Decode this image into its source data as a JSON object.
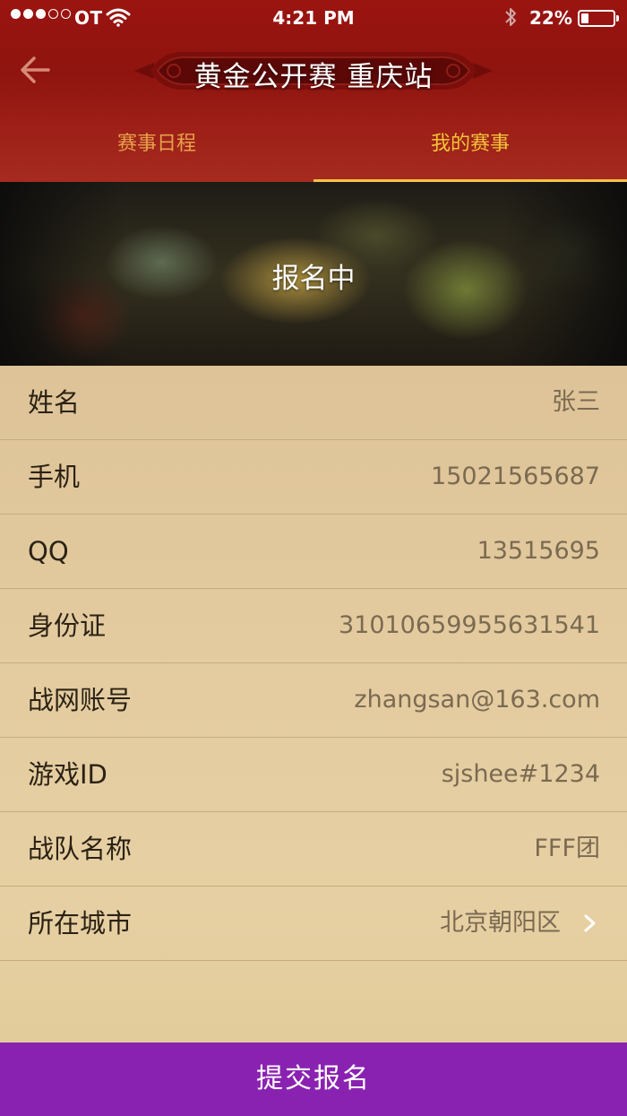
{
  "status_bar": {
    "carrier": "OT",
    "time": "4:21 PM",
    "battery": "22%",
    "signal_bars": 3
  },
  "header": {
    "title": "黄金公开赛 重庆站",
    "back_icon": "back-arrow-icon"
  },
  "tabs": [
    {
      "label": "赛事日程",
      "active": false
    },
    {
      "label": "我的赛事",
      "active": true
    }
  ],
  "hero": {
    "status": "报名中"
  },
  "form": {
    "rows": [
      {
        "label": "姓名",
        "value": "张三"
      },
      {
        "label": "手机",
        "value": "15021565687"
      },
      {
        "label": "QQ",
        "value": "13515695"
      },
      {
        "label": "身份证",
        "value": "310106599556315​41"
      },
      {
        "label": "战网账号",
        "value": "zhangsan@163.com"
      },
      {
        "label": "游戏ID",
        "value": "sjshee#1234"
      },
      {
        "label": "战队名称",
        "value": "FFF团"
      },
      {
        "label": "所在城市",
        "value": "北京朝阳区"
      }
    ]
  },
  "submit_label": "提交报名",
  "colors": {
    "header_red": "#9b1410",
    "tab_active": "#f4c437",
    "tab_inactive": "#e6a24a",
    "submit_purple": "#8a22b1",
    "parchment": "#e3cb9f"
  }
}
